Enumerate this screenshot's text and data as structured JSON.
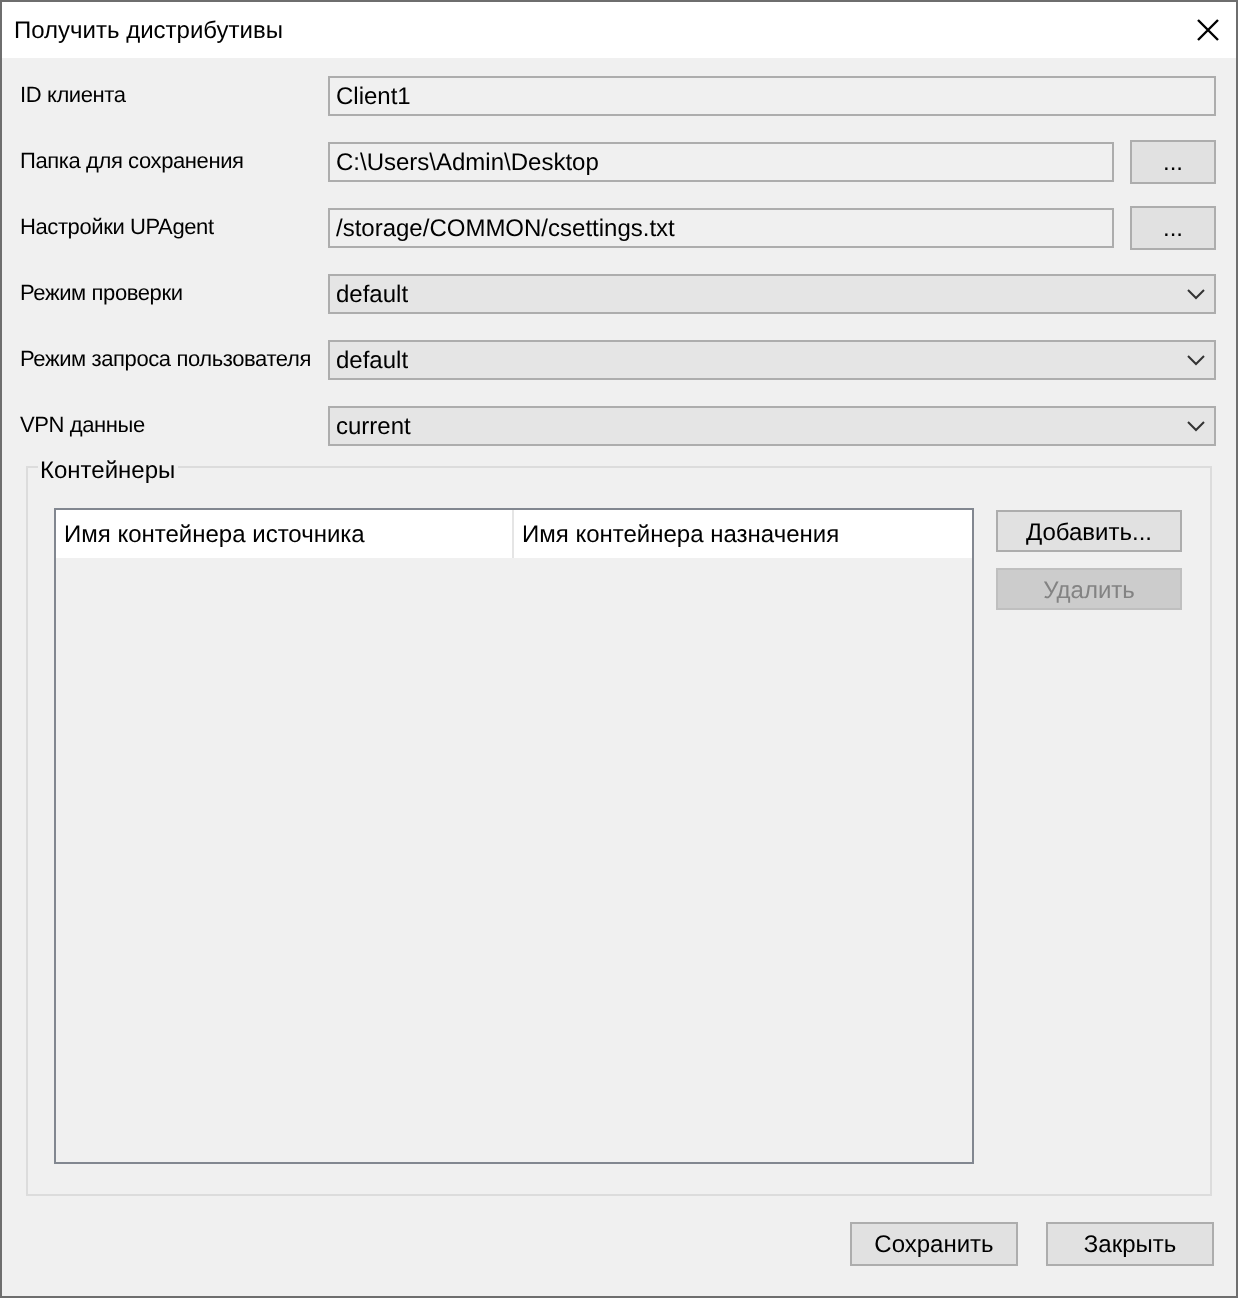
{
  "window": {
    "title": "Получить дистрибутивы"
  },
  "fields": [
    {
      "label": "ID клиента",
      "kind": "readonly",
      "value": "Client1"
    },
    {
      "label": "Папка для сохранения",
      "kind": "path",
      "value": "C:\\Users\\Admin\\Desktop",
      "button": "..."
    },
    {
      "label": "Настройки UPAgent",
      "kind": "path",
      "value": "/storage/COMMON/csettings.txt",
      "button": "..."
    },
    {
      "label": "Режим проверки",
      "kind": "select",
      "value": "default"
    },
    {
      "label": "Режим запроса пользователя",
      "kind": "select",
      "value": "default"
    },
    {
      "label": "VPN данные",
      "kind": "select",
      "value": "current"
    }
  ],
  "containers": {
    "title": "Контейнеры",
    "columns": [
      "Имя контейнера источника",
      "Имя контейнера назначения"
    ],
    "buttons": [
      {
        "label": "Добавить...",
        "disabled": false
      },
      {
        "label": "Удалить",
        "disabled": true
      }
    ]
  },
  "buttons": [
    "Сохранить",
    "Закрыть"
  ]
}
